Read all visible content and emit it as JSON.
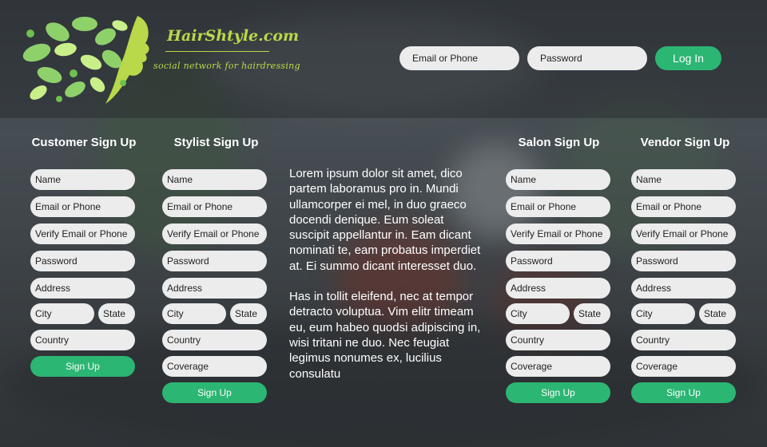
{
  "brand": {
    "name": "HairShtyle.com",
    "tagline": "social network for hairdressing"
  },
  "login": {
    "email_placeholder": "Email or Phone",
    "password_placeholder": "Password",
    "button_label": "Log In"
  },
  "customer": {
    "title": "Customer Sign Up",
    "fields": [
      "Name",
      "Email or Phone",
      "Verify Email or Phone",
      "Password",
      "Address",
      "City",
      "State",
      "Country"
    ],
    "button": "Sign Up"
  },
  "stylist": {
    "title": "Stylist Sign Up",
    "fields": [
      "Name",
      "Email or Phone",
      "Verify Email or Phone",
      "Password",
      "Address",
      "City",
      "State",
      "Country",
      "Coverage"
    ],
    "button": "Sign Up"
  },
  "salon": {
    "title": "Salon Sign Up",
    "fields": [
      "Name",
      "Email or Phone",
      "Verify Email or Phone",
      "Password",
      "Address",
      "City",
      "State",
      "Country",
      "Coverage"
    ],
    "button": "Sign Up"
  },
  "vendor": {
    "title": "Vendor Sign Up",
    "fields": [
      "Name",
      "Email or Phone",
      "Verify Email or Phone",
      "Password",
      "Address",
      "City",
      "State",
      "Country",
      "Coverage"
    ],
    "button": "Sign Up"
  },
  "lorem": {
    "p1": "Lorem ipsum dolor sit amet, dico partem laboramus pro in. Mundi ullamcorper ei mel, in duo graeco docendi denique. Eum soleat suscipit appellantur in. Eam dicant nominati te, eam probatus imperdiet at. Ei summo dicant interesset duo.",
    "p2": "Has in tollit eleifend, nec at tempor detracto voluptua. Vim elitr timeam eu, eum habeo quodsi adipiscing in, wisi tritani ne duo. Nec feugiat legimus nonumes ex, lucilius consulatu"
  },
  "colors": {
    "accent": "#2bb673",
    "brand": "#b9d84a",
    "field_bg": "#ececec"
  }
}
